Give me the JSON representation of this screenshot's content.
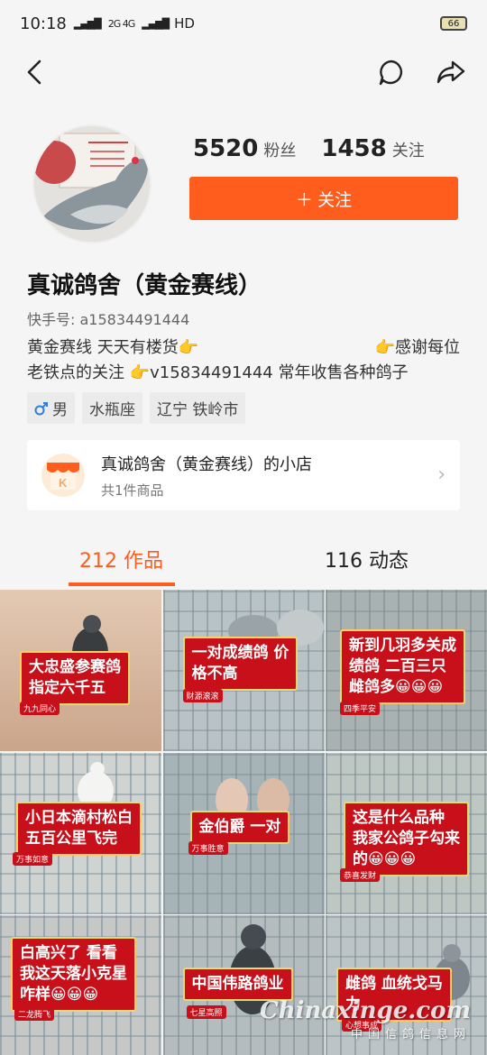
{
  "status_bar": {
    "time": "10:18",
    "net": "2G 4G",
    "hd": "HD",
    "battery": "66"
  },
  "profile": {
    "followers_count": "5520",
    "followers_label": "粉丝",
    "following_count": "1458",
    "following_label": "关注",
    "follow_button": "＋ 关注",
    "name": "真诚鸽舍（黄金赛线）",
    "kuaishou_id": "快手号: a15834491444",
    "bio_line1_left": "黄金赛线 天天有楼货👉",
    "bio_line1_right": "👉感谢每位",
    "bio_line2": "老铁点的关注 👉v15834491444 常年收售各种鸽子",
    "tags": [
      "男",
      "水瓶座",
      "辽宁 铁岭市"
    ],
    "gender_icon": "male-icon"
  },
  "shop": {
    "title": "真诚鸽舍（黄金赛线）的小店",
    "subtitle": "共1件商品"
  },
  "tabs": {
    "works": "212 作品",
    "moments": "116 动态"
  },
  "videos": [
    {
      "caption": "大忠盛参赛鸽\n指定六千五",
      "author": "九九同心"
    },
    {
      "caption": "一对成绩鸽 价\n格不高",
      "author": "财源滚滚"
    },
    {
      "caption": "新到几羽多关成\n绩鸽 二百三只\n雌鸽多😀😀😀",
      "author": "四季平安"
    },
    {
      "caption": "小日本滴村松白\n五百公里飞完",
      "author": "万事如意"
    },
    {
      "caption": "金伯爵 一对",
      "author": "万事胜意"
    },
    {
      "caption": "这是什么品种\n我家公鸽子勾来\n的😀😀😀",
      "author": "恭喜发财"
    },
    {
      "caption": "白高兴了 看看\n我这天落小克星\n咋样😀😀😀",
      "author": "二龙腾飞"
    },
    {
      "caption": "中国伟路鸽业",
      "author": "七星高照"
    },
    {
      "caption": "雌鸽 血统戈马\n力",
      "author": "心想事成"
    }
  ],
  "watermark": {
    "en": "Chinaxinge.com",
    "cn": "中国信鸽信息网"
  }
}
